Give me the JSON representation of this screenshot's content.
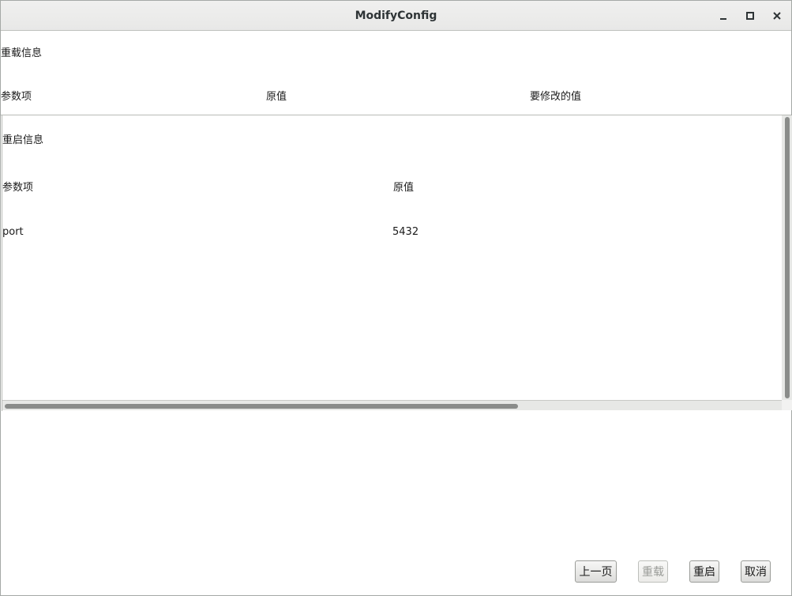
{
  "window": {
    "title": "ModifyConfig",
    "minimize_icon": "minimize-icon",
    "maximize_icon": "maximize-icon",
    "close_icon": "close-icon"
  },
  "reload_section": {
    "heading": "重载信息",
    "columns": [
      "参数项",
      "原值",
      "要修改的值"
    ]
  },
  "restart_section": {
    "heading": "重启信息",
    "columns": [
      "参数项",
      "原值"
    ],
    "rows": [
      {
        "param": "port",
        "original": "5432"
      }
    ]
  },
  "buttons": {
    "prev": "上一页",
    "reload": "重载",
    "restart": "重启",
    "cancel": "取消"
  },
  "colors": {
    "titlebar": "#e8e8e7",
    "scroll_thumb": "#8a8c8a",
    "disabled_text": "#9a9c98"
  }
}
